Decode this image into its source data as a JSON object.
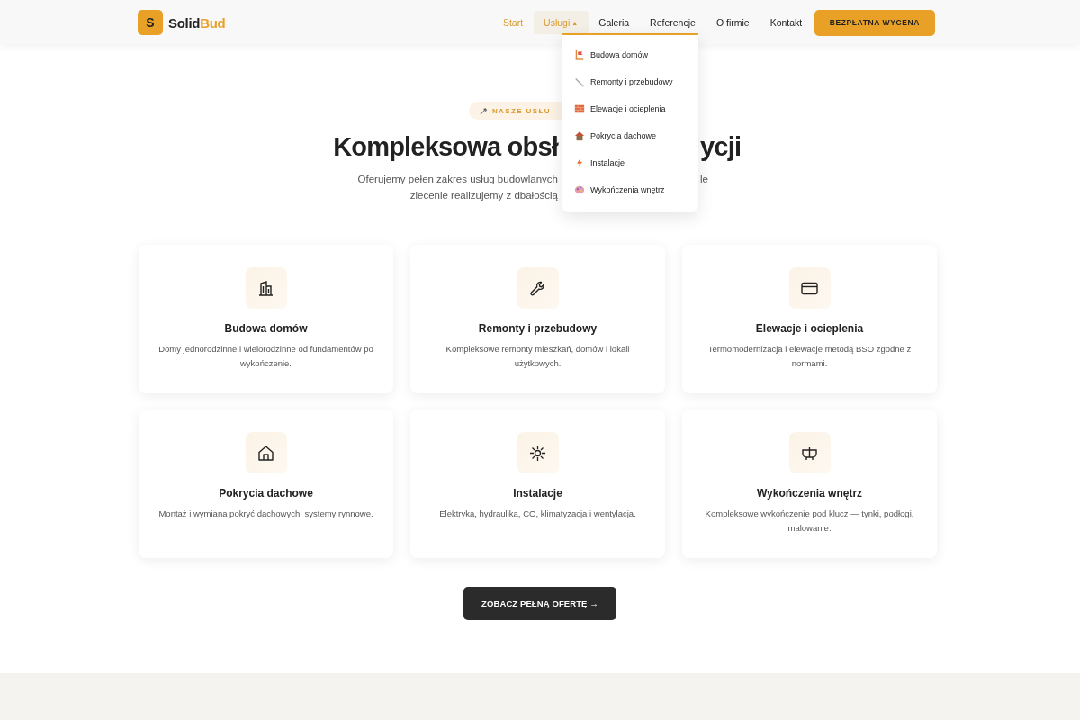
{
  "header": {
    "logo_letter": "S",
    "brand": "Solid",
    "brand_accent": "Bud"
  },
  "nav": [
    {
      "label": "Start",
      "selected": true,
      "kind": "link"
    },
    {
      "label": "Usługi",
      "selected": true,
      "kind": "dropdown",
      "expanded": true,
      "caret": "▲"
    },
    {
      "label": "Galeria",
      "selected": false,
      "kind": "link"
    },
    {
      "label": "Referencje",
      "selected": false,
      "kind": "link"
    },
    {
      "label": "O firmie",
      "selected": false,
      "kind": "link"
    },
    {
      "label": "Kontakt",
      "selected": false,
      "kind": "link"
    }
  ],
  "cta_button": "BEZPŁATNA WYCENA",
  "dropdown": [
    {
      "label": "Budowa domów"
    },
    {
      "label": "Remonty i przebudowy"
    },
    {
      "label": "Elewacje i ocieplenia"
    },
    {
      "label": "Pokrycia dachowe"
    },
    {
      "label": "Instalacje"
    },
    {
      "label": "Wykończenia wnętrz"
    }
  ],
  "hero": {
    "badge": "NASZE USŁU",
    "title_left": "Kompleksowa obsł",
    "title_right": "ycji",
    "intro_line1_left": "Oferujemy pełen zakres usług budowlanych",
    "intro_line1_right": "le",
    "intro_line2_left": "zlecenie realizujemy z dbałością"
  },
  "services": [
    {
      "title": "Budowa domów",
      "text": "Domy jednorodzinne i wielorodzinne od fundamentów po wykończenie."
    },
    {
      "title": "Remonty i przebudowy",
      "text": "Kompleksowe remonty mieszkań, domów i lokali użytkowych."
    },
    {
      "title": "Elewacje i ocieplenia",
      "text": "Termomodernizacja i elewacje metodą BSO zgodne z normami."
    },
    {
      "title": "Pokrycia dachowe",
      "text": "Montaż i wymiana pokryć dachowych, systemy rynnowe."
    },
    {
      "title": "Instalacje",
      "text": "Elektryka, hydraulika, CO, klimatyzacja i wentylacja."
    },
    {
      "title": "Wykończenia wnętrz",
      "text": "Kompleksowe wykończenie pod klucz — tynki, podłogi, malowanie."
    }
  ],
  "offer_button": "ZOBACZ PEŁNĄ OFERTĘ →"
}
